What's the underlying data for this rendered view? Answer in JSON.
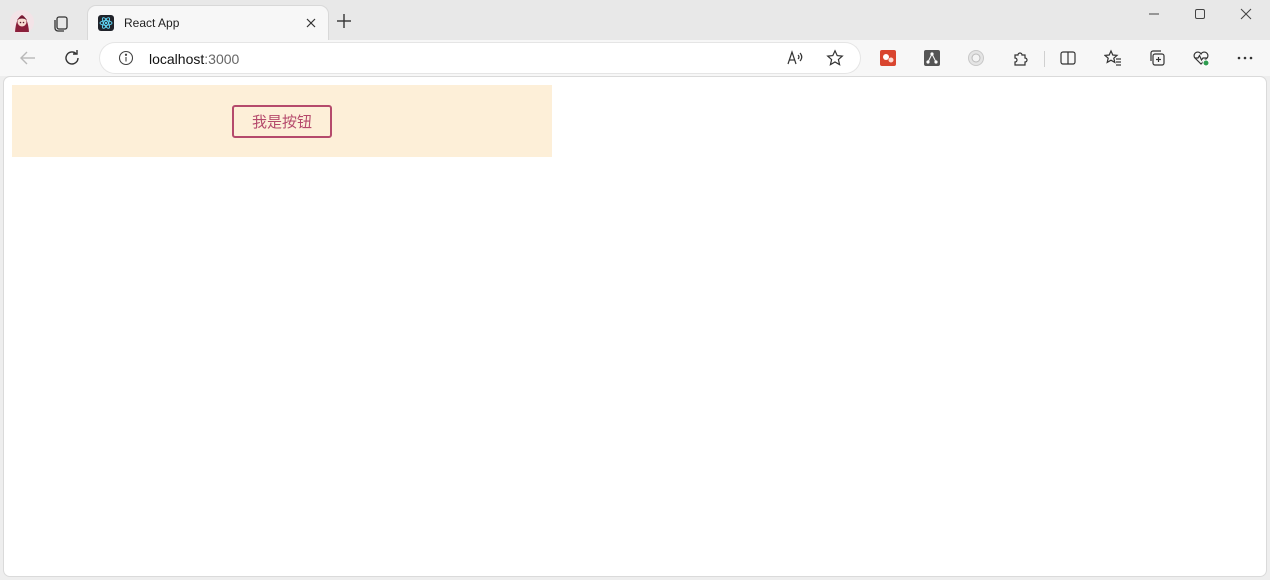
{
  "colors": {
    "app_box_background": "#fdefd8",
    "button_border": "#b54a6c",
    "button_text": "#b54a6c",
    "react_logo": "#61dafb"
  },
  "icons": {
    "profile": "profile-avatar-icon",
    "workspaces": "workspaces-icon",
    "favicon": "react-logo-icon",
    "close_tab": "close-icon",
    "new_tab": "plus-icon",
    "back": "back-arrow-icon",
    "refresh": "refresh-icon",
    "site_info": "info-icon",
    "read_aloud": "read-aloud-icon",
    "favorite": "star-icon",
    "extensions": [
      "red-puzzle-extension-icon",
      "network-extension-icon",
      "gray-circle-extension-icon",
      "puzzle-extensions-icon"
    ],
    "split_screen": "split-screen-icon",
    "favorites": "favorites-list-icon",
    "collections": "collections-icon",
    "browser_essentials": "heartbeat-icon",
    "more": "more-icon"
  },
  "tab": {
    "title": "React App"
  },
  "address_bar": {
    "host": "localhost",
    "port": ":3000"
  },
  "app": {
    "button_label": "我是按钮"
  }
}
